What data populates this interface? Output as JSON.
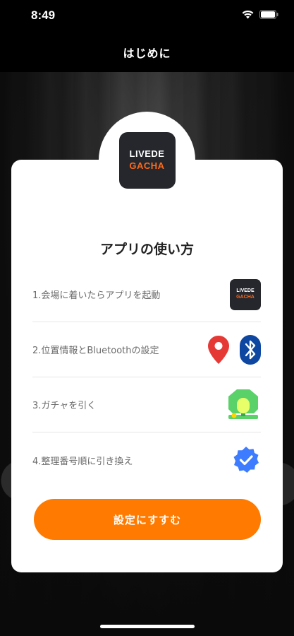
{
  "status_bar": {
    "time": "8:49"
  },
  "nav": {
    "title": "はじめに"
  },
  "app_logo": {
    "line1": "LIVEDE",
    "line2": "GACHA"
  },
  "card": {
    "title": "アプリの使い方",
    "steps": [
      {
        "label": "1.会場に着いたらアプリを起動",
        "icons": [
          "app-logo-icon"
        ]
      },
      {
        "label": "2.位置情報とBluetoothの設定",
        "icons": [
          "location-pin-icon",
          "bluetooth-icon"
        ]
      },
      {
        "label": "3.ガチャを引く",
        "icons": [
          "gacha-machine-icon"
        ]
      },
      {
        "label": "4.整理番号順に引き換え",
        "icons": [
          "verified-check-icon"
        ]
      }
    ],
    "cta_label": "設定にすすむ"
  },
  "colors": {
    "accent": "#ff7a00",
    "location": "#e53935",
    "bluetooth": "#0d47a1",
    "gacha": "#5bd16a",
    "check": "#3d7bff"
  }
}
